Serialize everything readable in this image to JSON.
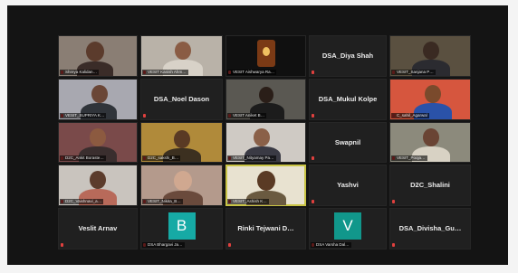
{
  "colors": {
    "background": "#141414",
    "tile": "#202020",
    "active_speaker": "#c9c445",
    "mic_muted": "#e0403e",
    "avatar_b": "#16aaa5",
    "avatar_v": "#11978b"
  },
  "tiles": [
    {
      "kind": "video",
      "caption": "Shreya Kalidan…"
    },
    {
      "kind": "video",
      "caption": "VESIT Kanish Ahm…"
    },
    {
      "kind": "video",
      "caption": "VESIT Aishwarya Ra…"
    },
    {
      "kind": "name",
      "name": "DSA_Diya Shah"
    },
    {
      "kind": "video",
      "caption": "VESIT_Sanjana P…"
    },
    {
      "kind": "video",
      "caption": "VESIT_SUPRIYA K…"
    },
    {
      "kind": "name",
      "name": "DSA_Noel Dason"
    },
    {
      "kind": "video",
      "caption": "VESIT Aniket B…"
    },
    {
      "kind": "name",
      "name": "DSA_Mukul Kolpe"
    },
    {
      "kind": "video",
      "caption": "C_sahil_Agarwal"
    },
    {
      "kind": "video",
      "caption": "D2C_Ankit Boraste…"
    },
    {
      "kind": "video",
      "caption": "D2C_sakshi_B…"
    },
    {
      "kind": "video",
      "caption": "VESIT_Nityamay Pa…"
    },
    {
      "kind": "name",
      "name": "Swapnil"
    },
    {
      "kind": "video",
      "caption": "VESIT_Pooja…"
    },
    {
      "kind": "video",
      "caption": "D2C_Vaishnavi_a…"
    },
    {
      "kind": "video",
      "caption": "VESIT_Nikita_B…"
    },
    {
      "kind": "video",
      "caption": "VESIT_Ashish K…"
    },
    {
      "kind": "name",
      "name": "Yashvi"
    },
    {
      "kind": "name",
      "name": "D2C_Shalini"
    },
    {
      "kind": "name",
      "name": "Veslit Arnav"
    },
    {
      "kind": "avatar",
      "letter": "B",
      "caption": "DSA Bhargavi Ja…"
    },
    {
      "kind": "name",
      "name": "Rinki Tejwani D…"
    },
    {
      "kind": "avatar",
      "letter": "V",
      "caption": "DSA Varsha Dal…"
    },
    {
      "kind": "name",
      "name": "DSA_Divisha_Gu…"
    }
  ]
}
